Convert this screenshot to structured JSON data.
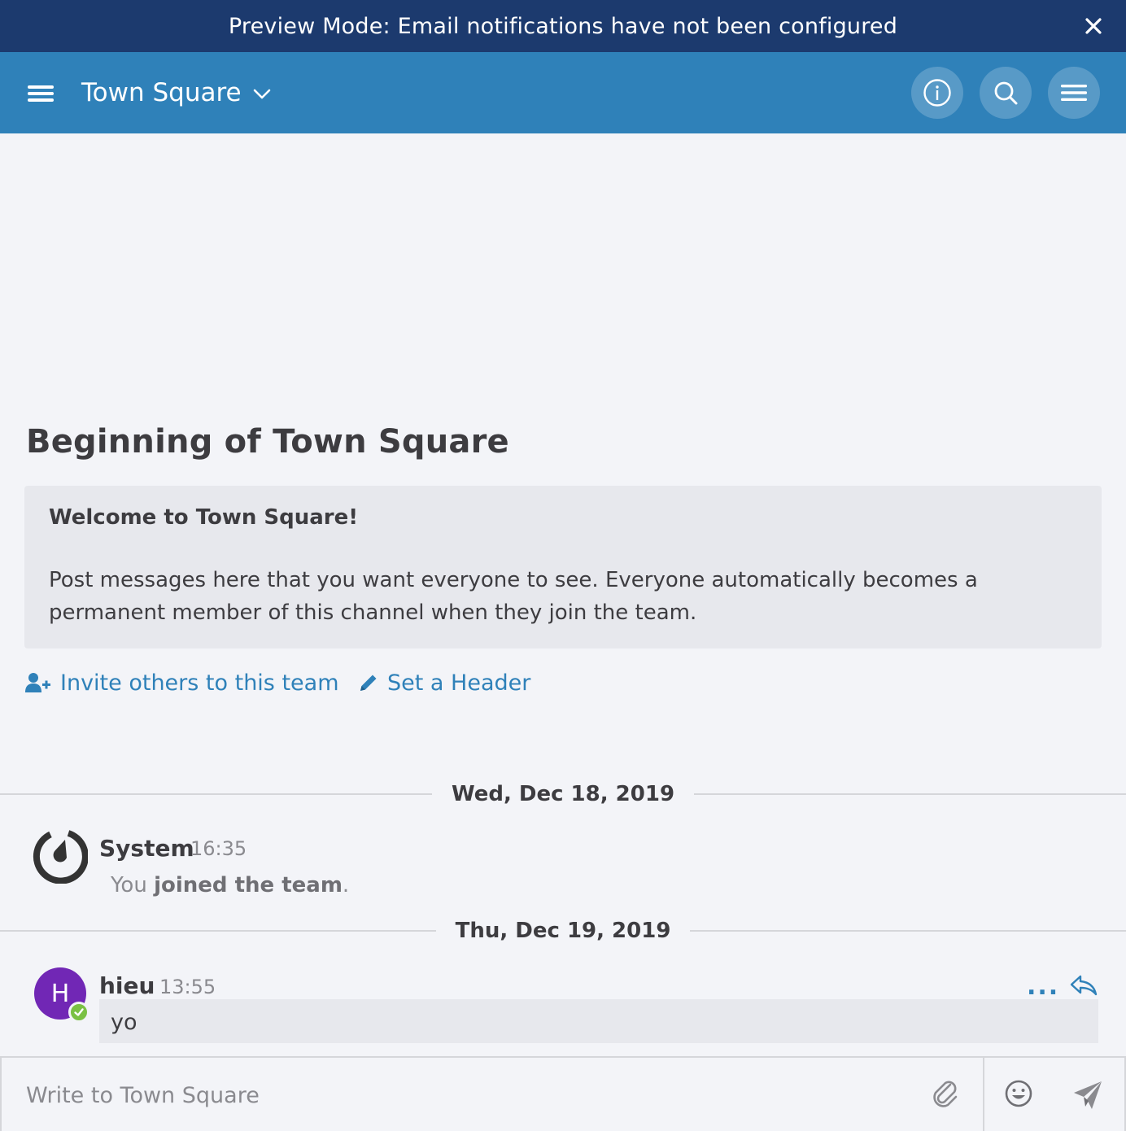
{
  "banner": {
    "text": "Preview Mode: Email notifications have not been configured",
    "close_icon": "close-icon"
  },
  "header": {
    "channel_name": "Town Square",
    "icons": [
      "hamburger-icon",
      "chevron-down-icon",
      "info-icon",
      "search-icon",
      "menu-icon"
    ],
    "color": "#2f81b9"
  },
  "intro": {
    "title": "Beginning of Town Square",
    "welcome_heading": "Welcome to Town Square!",
    "welcome_body": "Post messages here that you want everyone to see. Everyone automatically becomes a permanent member of this channel when they join the team."
  },
  "actions": {
    "invite_label": "Invite others to this team",
    "header_label": "Set a Header"
  },
  "posts": [
    {
      "date_separator": "Wed, Dec 18, 2019",
      "author": "System",
      "time": "16:35",
      "message_prefix": "You ",
      "message_bold": "joined the team",
      "message_suffix": "."
    },
    {
      "date_separator": "Thu, Dec 19, 2019",
      "author": "hieu",
      "avatar_letter": "H",
      "time": "13:55",
      "message": "yo",
      "more_label": "..."
    }
  ],
  "composer": {
    "placeholder": "Write to Town Square",
    "icons": [
      "attachment-icon",
      "emoji-icon",
      "send-icon"
    ]
  }
}
